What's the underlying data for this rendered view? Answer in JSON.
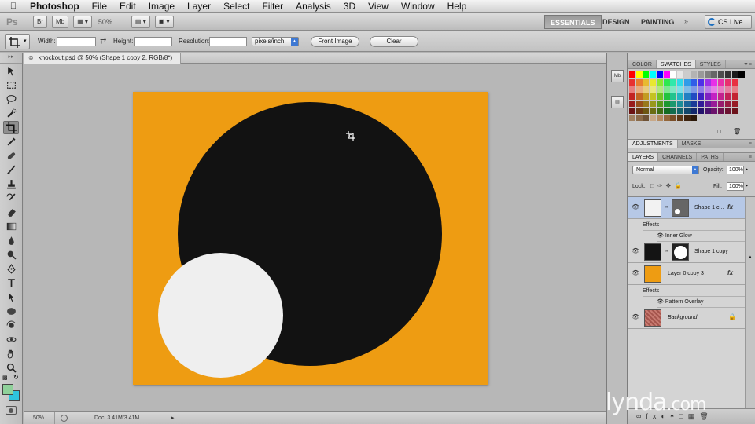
{
  "menubar": {
    "app": "Photoshop",
    "items": [
      "File",
      "Edit",
      "Image",
      "Layer",
      "Select",
      "Filter",
      "Analysis",
      "3D",
      "View",
      "Window",
      "Help"
    ]
  },
  "appbar": {
    "logo": "Ps",
    "zoom": "50%",
    "workspaces": [
      "ESSENTIALS",
      "DESIGN",
      "PAINTING"
    ],
    "active_workspace": "ESSENTIALS",
    "cs_live": "CS Live"
  },
  "options": {
    "width_label": "Width:",
    "height_label": "Height:",
    "resolution_label": "Resolution:",
    "units": "pixels/inch",
    "front_image": "Front Image",
    "clear": "Clear"
  },
  "document": {
    "tab_title": "knockout.psd @ 50% (Shape 1 copy 2, RGB/8*)",
    "canvas_color": "#ee9c12",
    "big_circle_color": "#121212",
    "small_circle_color": "#efefef"
  },
  "status": {
    "zoom": "50%",
    "doc": "Doc: 3.41M/3.41M"
  },
  "swatch_panel": {
    "tabs": [
      "COLOR",
      "SWATCHES",
      "STYLES"
    ],
    "active": "SWATCHES"
  },
  "adjust_panel": {
    "tabs": [
      "ADJUSTMENTS",
      "MASKS"
    ],
    "active": "ADJUSTMENTS"
  },
  "layers_panel": {
    "tabs": [
      "LAYERS",
      "CHANNELS",
      "PATHS"
    ],
    "active": "LAYERS",
    "blend_mode": "Normal",
    "opacity_label": "Opacity:",
    "opacity": "100%",
    "lock_label": "Lock:",
    "fill_label": "Fill:",
    "fill": "100%",
    "layers": [
      {
        "name": "Shape 1 c...",
        "selected": true,
        "effects_label": "Effects",
        "effect": "Inner Glow"
      },
      {
        "name": "Shape 1 copy",
        "selected": false
      },
      {
        "name": "Layer 0 copy 3",
        "selected": false,
        "effects_label": "Effects",
        "effect": "Pattern Overlay"
      },
      {
        "name": "Background",
        "selected": false
      }
    ]
  },
  "watermark": {
    "brand": "lynda",
    "suffix": ".com"
  }
}
